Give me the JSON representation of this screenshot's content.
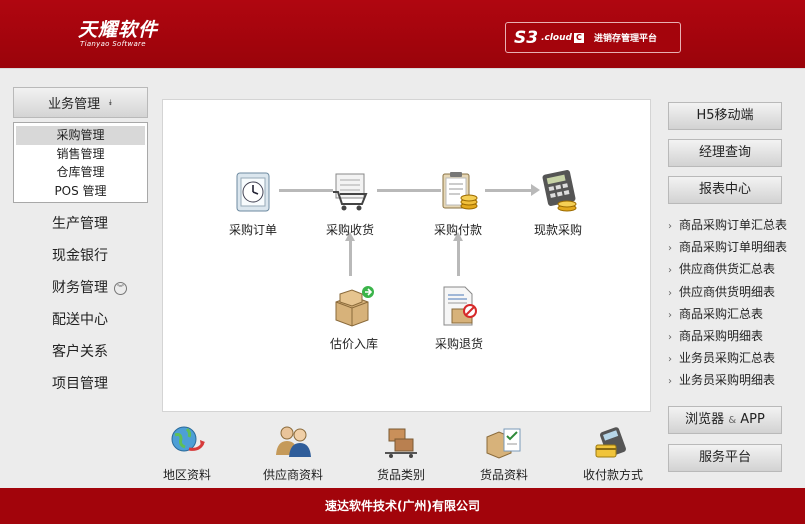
{
  "header": {
    "logo_cn": "天耀软件",
    "logo_en": "Tianyao Software",
    "platform_s3": "S3",
    "platform_cloud": ".cloud",
    "platform_c": "C",
    "platform_name": "进销存管理平台"
  },
  "left": {
    "business_label": "业务管理",
    "submenu": [
      "采购管理",
      "销售管理",
      "仓库管理",
      "POS 管理"
    ],
    "nav": [
      "生产管理",
      "现金银行",
      "财务管理",
      "配送中心",
      "客户关系",
      "项目管理"
    ]
  },
  "flow": {
    "order": "采购订单",
    "receive": "采购收货",
    "pay": "采购付款",
    "cash": "现款采购",
    "estimate": "估价入库",
    "return": "采购退货"
  },
  "bottom": [
    "地区资料",
    "供应商资料",
    "货品类别",
    "货品资料",
    "收付款方式"
  ],
  "right": {
    "h5": "H5移动端",
    "manager": "经理查询",
    "report_center": "报表中心",
    "reports": [
      "商品采购订单汇总表",
      "商品采购订单明细表",
      "供应商供货汇总表",
      "供应商供货明细表",
      "商品采购汇总表",
      "商品采购明细表",
      "业务员采购汇总表",
      "业务员采购明细表"
    ],
    "browser": "浏览器",
    "amp": "&",
    "app": "APP",
    "service": "服务平台"
  },
  "footer": "速达软件技术(广州)有限公司",
  "colors": {
    "brand_red": "#a8050d"
  }
}
